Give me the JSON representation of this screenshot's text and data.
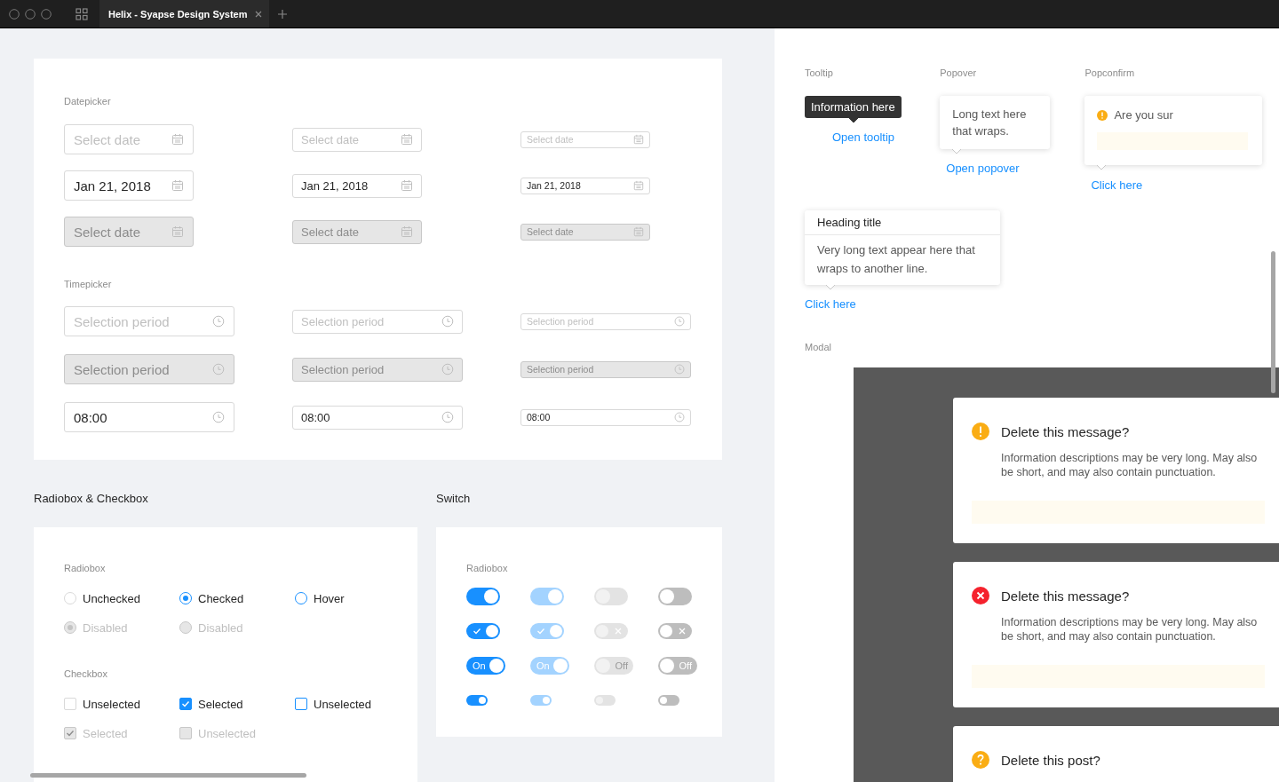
{
  "titlebar": {
    "tab": {
      "title": "Helix - Syapse Design System",
      "selected": true
    }
  },
  "picker": {
    "datepicker": {
      "label": "Datepicker",
      "fields": [
        {
          "kind": "large",
          "placeholder": "Select date",
          "disabled": false
        },
        {
          "kind": "medium",
          "placeholder": "Select date",
          "disabled": false
        },
        {
          "kind": "small",
          "placeholder": "Select date",
          "disabled": false
        },
        {
          "kind": "large",
          "value": "Jan 21, 2018",
          "disabled": false
        },
        {
          "kind": "medium",
          "value": "Jan 21, 2018",
          "disabled": false
        },
        {
          "kind": "small",
          "value": "Jan 21, 2018",
          "disabled": false
        },
        {
          "kind": "large",
          "placeholder": "Select date",
          "disabled": true
        },
        {
          "kind": "medium",
          "placeholder": "Select date",
          "disabled": true
        },
        {
          "kind": "small",
          "placeholder": "Select date",
          "disabled": true
        }
      ]
    },
    "timepicker": {
      "label": "Timepicker",
      "fields": [
        {
          "kind": "large",
          "placeholder": "Selection period",
          "disabled": false
        },
        {
          "kind": "medium",
          "placeholder": "Selection period",
          "disabled": false
        },
        {
          "kind": "small",
          "placeholder": "Selection period",
          "disabled": false
        },
        {
          "kind": "large",
          "placeholder": "Selection period",
          "disabled": true
        },
        {
          "kind": "medium",
          "placeholder": "Selection period",
          "disabled": true
        },
        {
          "kind": "small",
          "placeholder": "Selection period",
          "disabled": true
        },
        {
          "kind": "large",
          "value": "08:00",
          "disabled": false
        },
        {
          "kind": "medium",
          "value": "08:00",
          "disabled": false
        },
        {
          "kind": "small",
          "value": "08:00",
          "disabled": false
        }
      ]
    }
  },
  "radio_checkbox": {
    "title": "Radiobox & Checkbox",
    "radiobox": {
      "label": "Radiobox",
      "items": [
        {
          "kind": "normal",
          "label": "Unchecked",
          "checked": false,
          "disabled": false
        },
        {
          "kind": "normal",
          "label": "Checked",
          "checked": true,
          "disabled": false
        },
        {
          "kind": "hover",
          "label": "Hover",
          "checked": false,
          "disabled": false
        },
        {
          "kind": "normal",
          "label": "Disabled",
          "checked": true,
          "disabled": true
        },
        {
          "kind": "normal",
          "label": "Disabled",
          "checked": false,
          "disabled": true
        }
      ]
    },
    "checkbox": {
      "label": "Checkbox",
      "items": [
        {
          "kind": "normal",
          "label": "Unselected",
          "checked": false,
          "disabled": false
        },
        {
          "kind": "normal",
          "label": "Selected",
          "checked": true,
          "disabled": false
        },
        {
          "kind": "hover",
          "label": "Unselected",
          "checked": false,
          "disabled": false
        },
        {
          "kind": "normal",
          "label": "Selected",
          "checked": true,
          "disabled": true
        },
        {
          "kind": "normal",
          "label": "Unselected",
          "checked": false,
          "disabled": true
        }
      ]
    }
  },
  "switch": {
    "title": "Switch",
    "label": "Radiobox",
    "switches": [
      {
        "kind": "plain",
        "on": true,
        "disabled": false
      },
      {
        "kind": "plain",
        "on": true,
        "disabled": true
      },
      {
        "kind": "plain",
        "on": false,
        "disabled": true
      },
      {
        "kind": "plain",
        "on": false,
        "disabled": false
      },
      {
        "kind": "icon",
        "on": true,
        "disabled": false
      },
      {
        "kind": "icon",
        "on": true,
        "disabled": true
      },
      {
        "kind": "icon",
        "on": false,
        "disabled": true
      },
      {
        "kind": "icon",
        "on": false,
        "disabled": false
      },
      {
        "kind": "text",
        "on": true,
        "disabled": false,
        "text": "On"
      },
      {
        "kind": "text",
        "on": true,
        "disabled": true,
        "text": "On"
      },
      {
        "kind": "text",
        "on": false,
        "disabled": true,
        "text": "Off"
      },
      {
        "kind": "text",
        "on": false,
        "disabled": false,
        "text": "Off"
      },
      {
        "kind": "small",
        "on": true,
        "disabled": false
      },
      {
        "kind": "small",
        "on": true,
        "disabled": true
      },
      {
        "kind": "small",
        "on": false,
        "disabled": true
      },
      {
        "kind": "small",
        "on": false,
        "disabled": false
      }
    ]
  },
  "tooltip": {
    "label": "Tooltip",
    "text": "Information here",
    "link": "Open tooltip"
  },
  "popover": {
    "label": "Popover",
    "text": "Long text here that wraps.",
    "link": "Open popover"
  },
  "popconfirm": {
    "label": "Popconfirm",
    "text": "Are you sur",
    "link": "Click here"
  },
  "heading_popover": {
    "title": "Heading title",
    "text": "Very long text appear here that wraps to another line.",
    "link": "Click here"
  },
  "modal": {
    "label": "Modal",
    "dialogs": [
      {
        "kind": "warning",
        "title": "Delete this message?",
        "text": "Information descriptions may be very long. May also be short, and may also contain punctuation."
      },
      {
        "kind": "error",
        "title": "Delete this message?",
        "text": "Information descriptions may be very long. May also be short, and may also contain punctuation."
      },
      {
        "kind": "question",
        "title": "Delete this post?"
      }
    ]
  }
}
